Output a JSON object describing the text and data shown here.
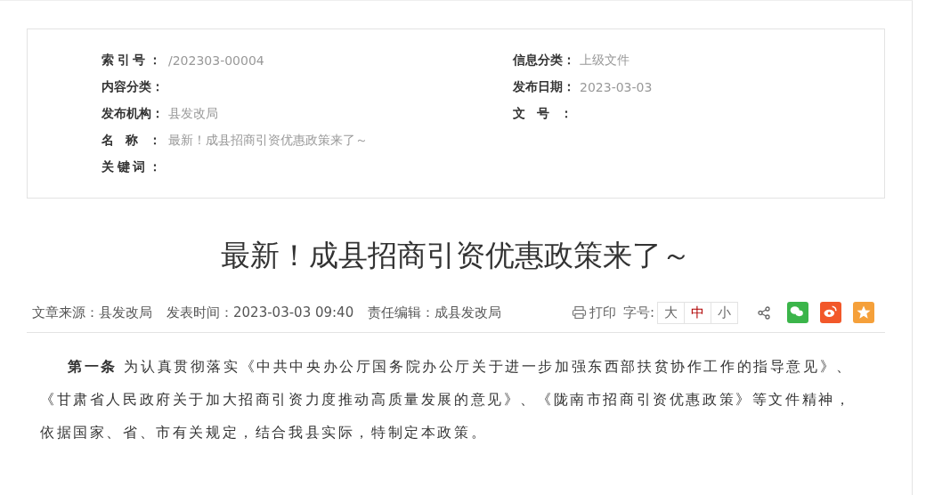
{
  "info": {
    "left": [
      {
        "label": "索引号：",
        "value": "/202303-00004"
      },
      {
        "label": "内容分类："
      },
      {
        "label": "发布机构：",
        "value": "县发改局"
      },
      {
        "label": "名称：",
        "value": "最新！成县招商引资优惠政策来了～"
      },
      {
        "label": "关键词："
      }
    ],
    "right": [
      {
        "label": "信息分类：",
        "value": "上级文件"
      },
      {
        "label": "发布日期：",
        "value": "2023-03-03"
      },
      {
        "label": "文号："
      }
    ]
  },
  "title": "最新！成县招商引资优惠政策来了～",
  "meta": [
    "文章来源：县发改局",
    "发表时间：2023-03-03 09:40",
    "责任编辑：成县发改局"
  ],
  "print": "打印",
  "font_size_label": "字号:",
  "font_sizes": [
    {
      "label": "大",
      "selected": false
    },
    {
      "label": "中",
      "selected": true
    },
    {
      "label": "小",
      "selected": false
    }
  ],
  "share": [
    {
      "kind": "wechat",
      "color": "#3bb54a"
    },
    {
      "kind": "weibo",
      "color": "#f2582a"
    },
    {
      "kind": "favorite",
      "color": "#f5a03a"
    }
  ],
  "body": "**第一条**  为认真贯彻落实《中共中央办公厅国务院办公厅关于进一步加强东西部扶贫协作工作的指导意见》、《甘肃省人民政府关于加大招商引资力度推动高质量发展的意见》、《陇南市招商引资优惠政策》等文件精神，依据国家、省、市有关规定，结合我县实际，特制定本政策。"
}
